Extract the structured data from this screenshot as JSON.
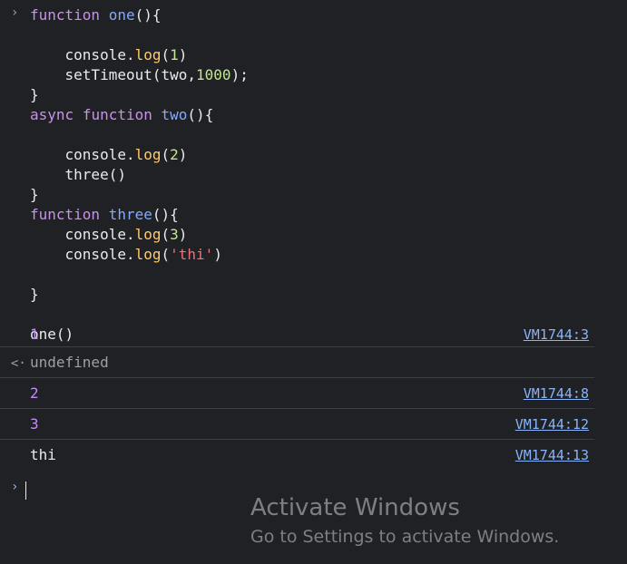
{
  "input": {
    "prompt": "›",
    "code": [
      [
        {
          "t": "function",
          "c": "kw"
        },
        {
          "t": " ",
          "c": "plain"
        },
        {
          "t": "one",
          "c": "fn"
        },
        {
          "t": "(){",
          "c": "plain"
        }
      ],
      [],
      [
        {
          "t": "    console.",
          "c": "plain"
        },
        {
          "t": "log",
          "c": "mth"
        },
        {
          "t": "(",
          "c": "plain"
        },
        {
          "t": "1",
          "c": "num"
        },
        {
          "t": ")",
          "c": "plain"
        }
      ],
      [
        {
          "t": "    setTimeout(two,",
          "c": "plain"
        },
        {
          "t": "1000",
          "c": "num"
        },
        {
          "t": ");",
          "c": "plain"
        }
      ],
      [
        {
          "t": "}",
          "c": "plain"
        }
      ],
      [
        {
          "t": "async",
          "c": "kw"
        },
        {
          "t": " ",
          "c": "plain"
        },
        {
          "t": "function",
          "c": "kw"
        },
        {
          "t": " ",
          "c": "plain"
        },
        {
          "t": "two",
          "c": "fn"
        },
        {
          "t": "(){",
          "c": "plain"
        }
      ],
      [],
      [
        {
          "t": "    console.",
          "c": "plain"
        },
        {
          "t": "log",
          "c": "mth"
        },
        {
          "t": "(",
          "c": "plain"
        },
        {
          "t": "2",
          "c": "num"
        },
        {
          "t": ")",
          "c": "plain"
        }
      ],
      [
        {
          "t": "    three()",
          "c": "plain"
        }
      ],
      [
        {
          "t": "}",
          "c": "plain"
        }
      ],
      [
        {
          "t": "function",
          "c": "kw"
        },
        {
          "t": " ",
          "c": "plain"
        },
        {
          "t": "three",
          "c": "fn"
        },
        {
          "t": "(){",
          "c": "plain"
        }
      ],
      [
        {
          "t": "    console.",
          "c": "plain"
        },
        {
          "t": "log",
          "c": "mth"
        },
        {
          "t": "(",
          "c": "plain"
        },
        {
          "t": "3",
          "c": "num"
        },
        {
          "t": ")",
          "c": "plain"
        }
      ],
      [
        {
          "t": "    console.",
          "c": "plain"
        },
        {
          "t": "log",
          "c": "mth"
        },
        {
          "t": "(",
          "c": "plain"
        },
        {
          "t": "'thi'",
          "c": "str"
        },
        {
          "t": ")",
          "c": "plain"
        }
      ],
      [],
      [
        {
          "t": "}",
          "c": "plain"
        }
      ],
      [],
      [
        {
          "t": "one()",
          "c": "plain"
        }
      ]
    ]
  },
  "output": [
    {
      "text": "1",
      "source": "VM1744:3"
    },
    {
      "text": "undefined",
      "source": ""
    },
    {
      "text": "2",
      "source": "VM1744:8"
    },
    {
      "text": "3",
      "source": "VM1744:12"
    },
    {
      "text": "thi",
      "source": "VM1744:13"
    }
  ],
  "return_icon": "<·",
  "console_prompt": "›",
  "watermark": {
    "title": "Activate Windows",
    "subtitle": "Go to Settings to activate Windows."
  }
}
